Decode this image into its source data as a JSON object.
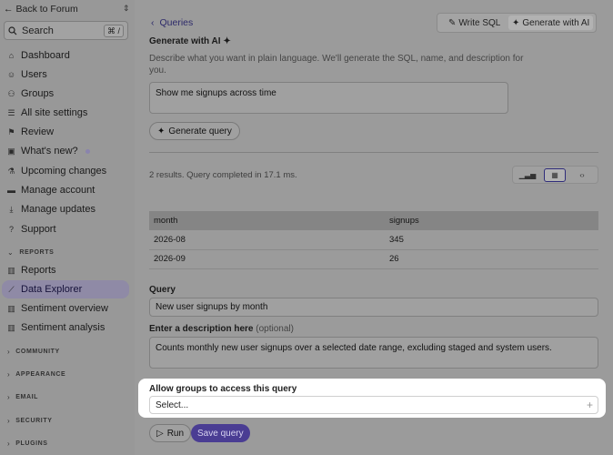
{
  "sidebar": {
    "back_label": "Back to Forum",
    "search_placeholder": "Search",
    "search_shortcut": "⌘ /",
    "items": [
      {
        "label": "Dashboard",
        "icon": "home-icon"
      },
      {
        "label": "Users",
        "icon": "users-icon"
      },
      {
        "label": "Groups",
        "icon": "groups-icon"
      },
      {
        "label": "All site settings",
        "icon": "list-icon"
      },
      {
        "label": "Review",
        "icon": "flag-icon"
      },
      {
        "label": "What's new?",
        "icon": "gift-icon"
      },
      {
        "label": "Upcoming changes",
        "icon": "flask-icon"
      },
      {
        "label": "Manage account",
        "icon": "card-icon"
      },
      {
        "label": "Manage updates",
        "icon": "download-icon"
      },
      {
        "label": "Support",
        "icon": "help-icon"
      }
    ],
    "reports_section": "REPORTS",
    "report_items": [
      {
        "label": "Reports",
        "icon": "chart-icon"
      },
      {
        "label": "Data Explorer",
        "icon": "line-chart-icon",
        "active": true
      },
      {
        "label": "Sentiment overview",
        "icon": "chart-icon"
      },
      {
        "label": "Sentiment analysis",
        "icon": "chart-icon"
      }
    ],
    "sections": [
      "COMMUNITY",
      "APPEARANCE",
      "EMAIL",
      "SECURITY",
      "PLUGINS"
    ]
  },
  "main": {
    "breadcrumb": "Queries",
    "write_sql_label": "Write SQL",
    "generate_ai_label": "Generate with AI",
    "ai_heading": "Generate with AI",
    "ai_description": "Describe what you want in plain language. We'll generate the SQL, name, and description for you.",
    "prompt_value": "Show me signups across time",
    "generate_button": "Generate query",
    "results_summary": "2 results. Query completed in 17.1 ms.",
    "table": {
      "headers": [
        "month",
        "signups"
      ],
      "rows": [
        [
          "2026-08",
          "345"
        ],
        [
          "2026-09",
          "26"
        ]
      ]
    },
    "query_label": "Query",
    "query_name": "New user signups by month",
    "description_label": "Enter a description here",
    "description_optional": "(optional)",
    "description_value": "Counts monthly new user signups over a selected date range, excluding staged and system users.",
    "groups_label": "Allow groups to access this query",
    "groups_placeholder": "Select...",
    "run_label": "Run",
    "save_label": "Save query"
  }
}
